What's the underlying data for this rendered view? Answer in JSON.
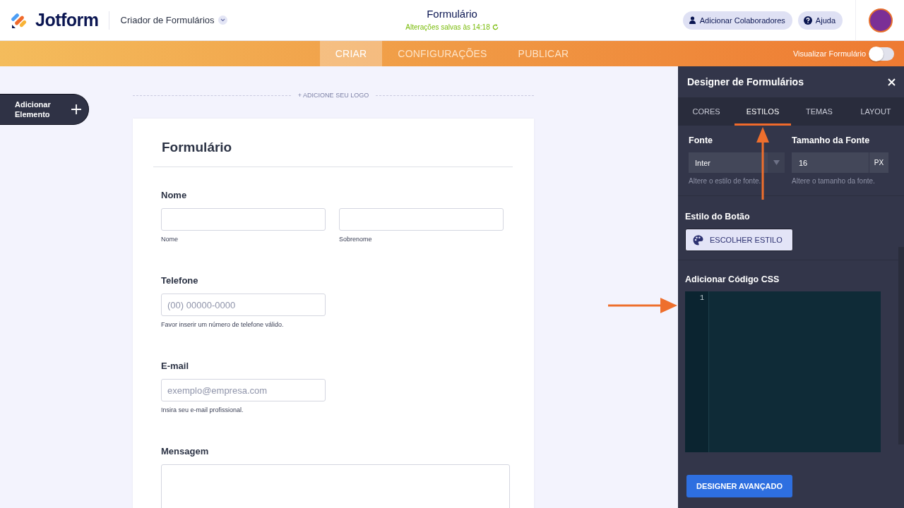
{
  "header": {
    "logo": "Jotform",
    "app_menu": "Criador de Formulários",
    "title": "Formulário",
    "save_status": "Alterações salvas às 14:18",
    "buttons": [
      {
        "kind": "collaborators",
        "label": "Adicionar Colaboradores"
      },
      {
        "kind": "help",
        "label": "Ajuda"
      }
    ]
  },
  "nav": {
    "tabs": [
      {
        "label": "CRIAR",
        "selected": true
      },
      {
        "label": "CONFIGURAÇÕES",
        "selected": false
      },
      {
        "label": "PUBLICAR",
        "selected": false
      }
    ],
    "preview": {
      "label": "Visualizar Formulário",
      "on": false
    }
  },
  "add_element": "Adicionar Elemento",
  "logo_placeholder": "+ ADICIONE SEU LOGO",
  "form": {
    "title": "Formulário",
    "fields": [
      {
        "kind": "name",
        "label": "Nome",
        "sublabels": [
          "Nome",
          "Sobrenome"
        ]
      },
      {
        "kind": "text",
        "label": "Telefone",
        "placeholder": "(00) 00000-0000",
        "hint": "Favor inserir um número de telefone válido."
      },
      {
        "kind": "text",
        "label": "E-mail",
        "placeholder": "exemplo@empresa.com",
        "hint": "Insira seu e-mail profissional."
      },
      {
        "kind": "textarea",
        "label": "Mensagem"
      }
    ]
  },
  "designer": {
    "title": "Designer de Formulários",
    "tabs": [
      {
        "label": "CORES",
        "selected": false
      },
      {
        "label": "ESTILOS",
        "selected": true
      },
      {
        "label": "TEMAS",
        "selected": false
      },
      {
        "label": "LAYOUT",
        "selected": false
      }
    ],
    "font": {
      "label": "Fonte",
      "value": "Inter",
      "hint": "Altere o estilo de fonte."
    },
    "font_size": {
      "label": "Tamanho da Fonte",
      "value": "16",
      "unit": "PX",
      "hint": "Altere o tamanho da fonte."
    },
    "button_style": {
      "label": "Estilo do Botão",
      "button": "ESCOLHER ESTILO"
    },
    "css": {
      "label": "Adicionar Código CSS",
      "line_numbers": [
        "1"
      ]
    },
    "advanced_button": "DESIGNER AVANÇADO"
  }
}
